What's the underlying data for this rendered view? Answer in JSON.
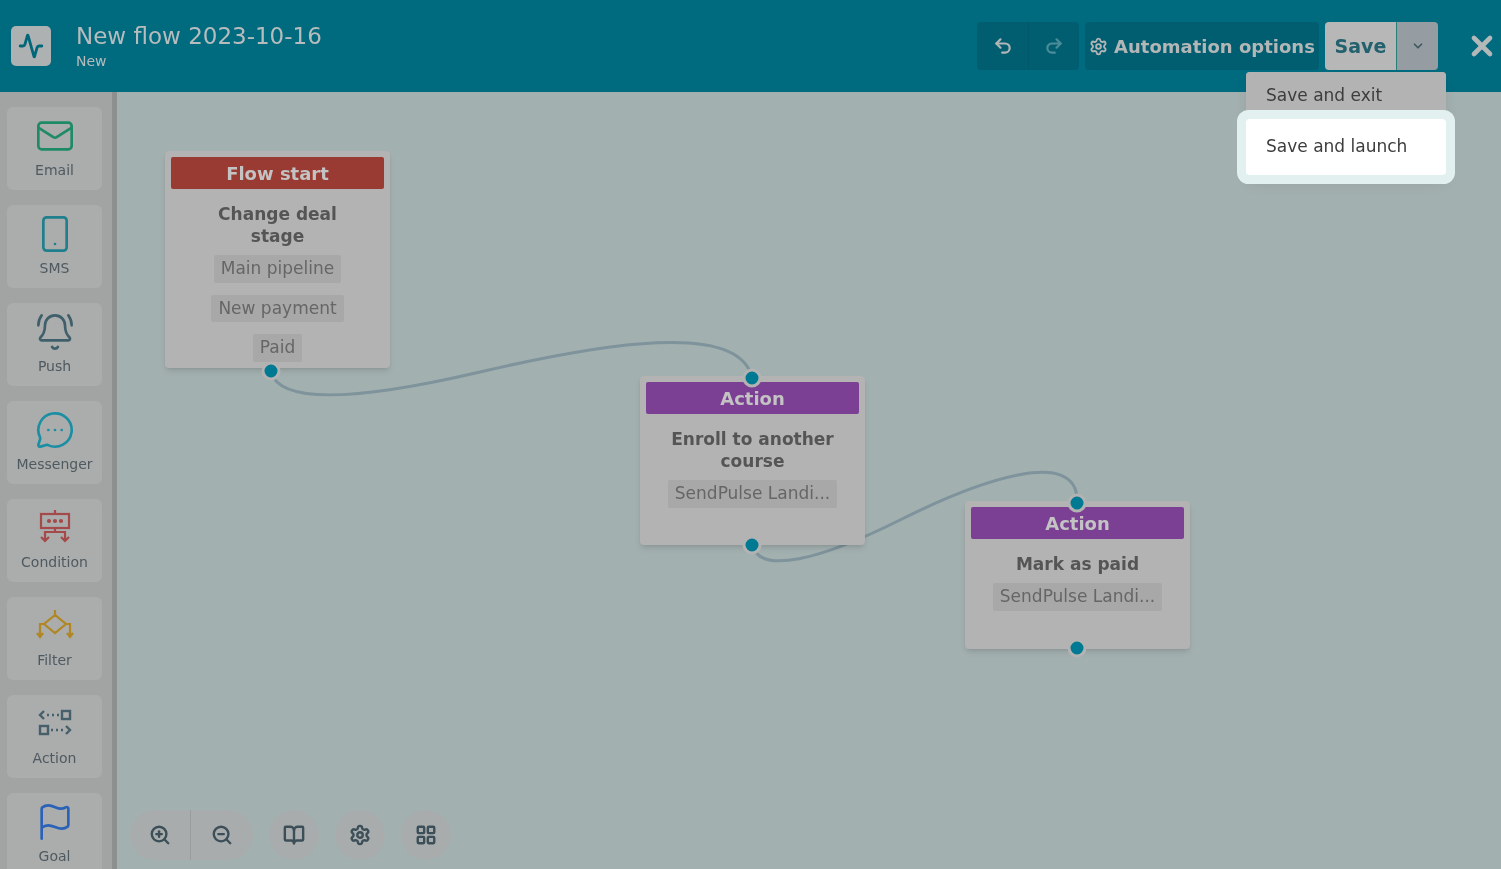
{
  "header": {
    "title": "New flow 2023-10-16",
    "subtitle": "New",
    "automation_options": "Automation options",
    "save": "Save"
  },
  "save_menu": [
    {
      "label": "Save and exit",
      "highlighted": false
    },
    {
      "label": "Save and launch",
      "highlighted": true
    }
  ],
  "sidebar": {
    "items": [
      {
        "label": "Email",
        "kind": "email",
        "color": "#1e8a66"
      },
      {
        "label": "SMS",
        "kind": "sms",
        "color": "#1f7f8c"
      },
      {
        "label": "Push",
        "kind": "push",
        "color": "#3f5f6b"
      },
      {
        "label": "Messenger",
        "kind": "messenger",
        "color": "#1a8fa3"
      },
      {
        "label": "Condition",
        "kind": "condition",
        "color": "#a54a4a"
      },
      {
        "label": "Filter",
        "kind": "filter",
        "color": "#b08722"
      },
      {
        "label": "Action",
        "kind": "action",
        "color": "#46606b"
      },
      {
        "label": "Goal",
        "kind": "goal",
        "color": "#2a62b8"
      }
    ]
  },
  "nodes": [
    {
      "kind": "start",
      "header": "Flow start",
      "title": "Change deal stage",
      "chips": [
        "Main pipeline",
        "New payment",
        "Paid"
      ]
    },
    {
      "kind": "action",
      "header": "Action",
      "title": "Enroll to another course",
      "chips": [
        "SendPulse Landi..."
      ]
    },
    {
      "kind": "action",
      "header": "Action",
      "title": "Mark as paid",
      "chips": [
        "SendPulse Landi..."
      ]
    }
  ]
}
